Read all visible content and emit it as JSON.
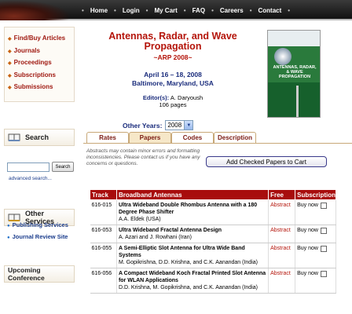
{
  "nav": {
    "items": [
      "Home",
      "Login",
      "My Cart",
      "FAQ",
      "Careers",
      "Contact"
    ]
  },
  "sidebar": {
    "links": [
      "Find/Buy Articles",
      "Journals",
      "Proceedings",
      "Subscriptions",
      "Submissions"
    ],
    "search_title": "Search",
    "search_button": "Search",
    "advanced_search": "advanced search...",
    "other_services_title": "Other Services",
    "other_services": [
      "Publishing Services",
      "Journal Review Site"
    ],
    "upcoming_title": "Upcoming Conference"
  },
  "conference": {
    "title_line1": "Antennas, Radar, and Wave",
    "title_line2": "Propagation",
    "abbr": "~ARP 2008~",
    "dates": "April 16 – 18, 2008",
    "location": "Baltimore, Maryland, USA",
    "editor_label": "Editor(s):",
    "editor_name": "A. Daryoush",
    "pages": "106 pages",
    "other_years_label": "Other Years:",
    "year_selected": "2008"
  },
  "cover": {
    "title": "ANTENNAS, RADAR, & WAVE PROPAGATION"
  },
  "tabs": [
    "Rates",
    "Papers",
    "Codes",
    "Description"
  ],
  "active_tab": "Papers",
  "note": "Abstracts may contain minor errors and formatting inconsistencies. Please contact us if you have any concerns or questions.",
  "add_button": "Add Checked Papers to Cart",
  "table": {
    "headers": [
      "Track",
      "Broadband Antennas",
      "Free",
      "Subscription"
    ],
    "rows": [
      {
        "track": "616-015",
        "title": "Ultra Wideband Double Rhombus Antenna with a 180 Degree Phase Shifter",
        "authors": "A.A. Eldek (USA)",
        "free": "Abstract",
        "buy": "Buy now"
      },
      {
        "track": "616-053",
        "title": "Ultra Wideband Fractal Antenna Design",
        "authors": "A. Azari and J. Rowhani (Iran)",
        "free": "Abstract",
        "buy": "Buy now"
      },
      {
        "track": "616-055",
        "title": "A Semi-Elliptic Slot Antenna for Ultra Wide Band Systems",
        "authors": "M. Gopikrishna, D.D. Krishna, and C.K. Aanandan (India)",
        "free": "Abstract",
        "buy": "Buy now"
      },
      {
        "track": "616-056",
        "title": "A Compact Wideband Koch Fractal Printed Slot Antenna for WLAN Applications",
        "authors": "D.D. Krishna, M. Gopikrishna, and C.K. Aanandan (India)",
        "free": "Abstract",
        "buy": "Buy now"
      }
    ]
  }
}
